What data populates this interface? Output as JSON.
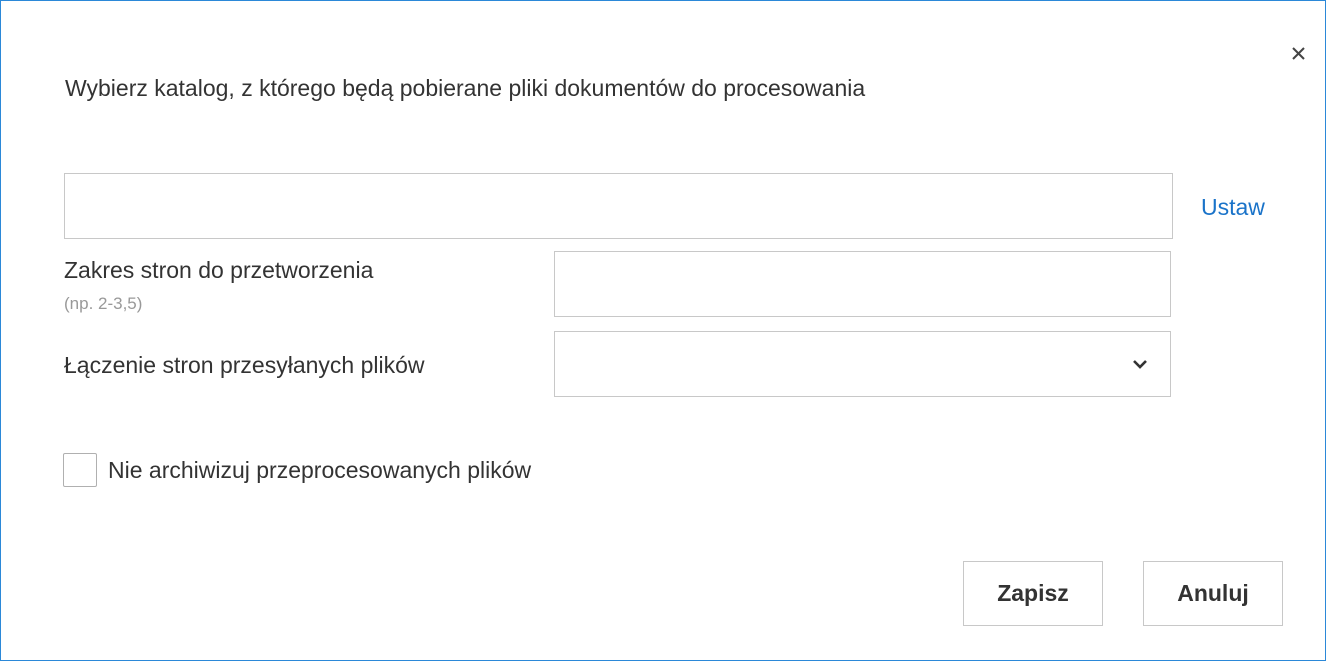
{
  "dialog": {
    "title": "Wybierz katalog, z którego będą pobierane pliki dokumentów do procesowania",
    "close_icon": "close-icon"
  },
  "folder": {
    "value": "",
    "placeholder": "",
    "set_link": "Ustaw"
  },
  "page_range": {
    "label": "Zakres stron do przetworzenia",
    "hint": "(np. 2-3,5)",
    "value": ""
  },
  "merge_pages": {
    "label": "Łączenie stron przesyłanych plików",
    "selected": "",
    "icon": "chevron-down-icon"
  },
  "archive": {
    "label": "Nie archiwizuj przeprocesowanych plików",
    "checked": false
  },
  "buttons": {
    "save": "Zapisz",
    "cancel": "Anuluj"
  },
  "colors": {
    "border_accent": "#2b88d8",
    "link": "#1a73c9",
    "text": "#333333",
    "hint": "#999999"
  }
}
